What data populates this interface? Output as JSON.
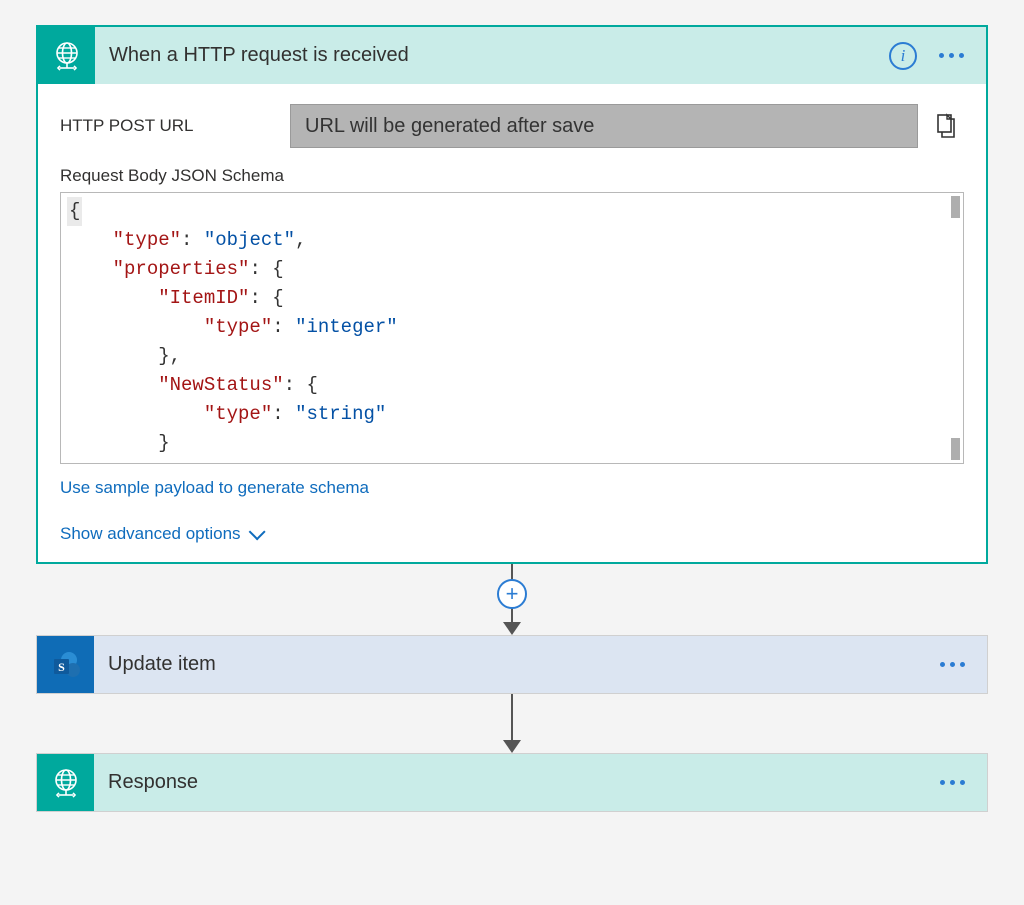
{
  "trigger": {
    "title": "When a HTTP request is received",
    "urlLabel": "HTTP POST URL",
    "urlPlaceholder": "URL will be generated after save",
    "schemaLabel": "Request Body JSON Schema",
    "schema": {
      "line1": "{",
      "line2_prop": "\"type\"",
      "line2_val": "\"object\"",
      "line3_prop": "\"properties\"",
      "line4_prop": "\"ItemID\"",
      "line5_prop": "\"type\"",
      "line5_val": "\"integer\"",
      "line7_prop": "\"NewStatus\"",
      "line8_prop": "\"type\"",
      "line8_val": "\"string\""
    },
    "samplePayloadLink": "Use sample payload to generate schema",
    "advancedOptionsLink": "Show advanced options"
  },
  "step2": {
    "title": "Update item"
  },
  "step3": {
    "title": "Response"
  }
}
